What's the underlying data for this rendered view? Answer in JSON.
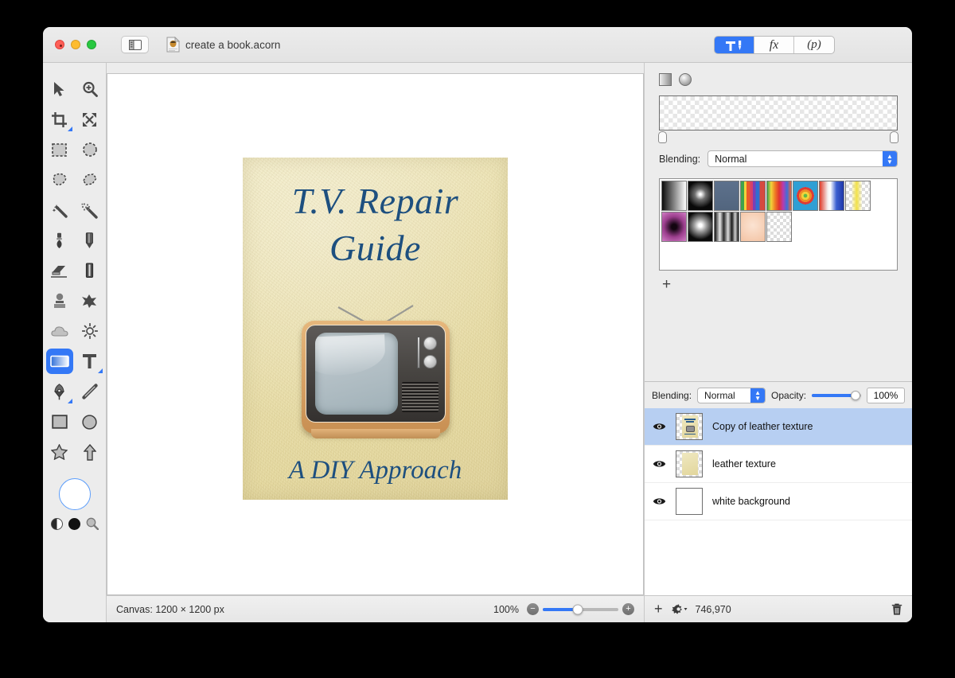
{
  "window": {
    "title": "create a book.acorn",
    "traffic_lights": [
      "close",
      "minimize",
      "zoom"
    ],
    "sidebar_toggle_icon": "sidebar-toggle-icon",
    "doc_icon": "acorn-document-icon"
  },
  "inspector_tabs": [
    {
      "id": "tools",
      "icon": "tools-hammer-icon",
      "label": "",
      "selected": true
    },
    {
      "id": "filters",
      "icon": "fx-icon",
      "label": "fx",
      "selected": false
    },
    {
      "id": "palettes",
      "icon": "palette-p-icon",
      "label": "(p)",
      "selected": false
    }
  ],
  "tools": {
    "items": [
      {
        "name": "move-tool",
        "icon": "arrow-cursor-icon",
        "selected": false
      },
      {
        "name": "zoom-tool",
        "icon": "magnifier-plus-icon",
        "selected": false
      },
      {
        "name": "crop-tool",
        "icon": "crop-icon",
        "selected": false,
        "has_options": true
      },
      {
        "name": "transform-tool",
        "icon": "move-arrows-icon",
        "selected": false
      },
      {
        "name": "rectangle-select-tool",
        "icon": "marquee-rect-icon",
        "selected": false
      },
      {
        "name": "ellipse-select-tool",
        "icon": "marquee-ellipse-icon",
        "selected": false
      },
      {
        "name": "lasso-tool",
        "icon": "lasso-icon",
        "selected": false
      },
      {
        "name": "polygon-lasso-tool",
        "icon": "polygon-lasso-icon",
        "selected": false
      },
      {
        "name": "magic-wand-tool",
        "icon": "magic-wand-icon",
        "selected": false
      },
      {
        "name": "instant-alpha-tool",
        "icon": "sparkle-wand-icon",
        "selected": false
      },
      {
        "name": "brush-tool",
        "icon": "paintbrush-icon",
        "selected": false
      },
      {
        "name": "pencil-tool",
        "icon": "pencil-icon",
        "selected": false
      },
      {
        "name": "eraser-tool",
        "icon": "eraser-icon",
        "selected": false
      },
      {
        "name": "paint-bucket-tool",
        "icon": "bucket-icon",
        "selected": false
      },
      {
        "name": "clone-stamp-tool",
        "icon": "clone-stamp-icon",
        "selected": false
      },
      {
        "name": "smudge-tool",
        "icon": "smudge-icon",
        "selected": false
      },
      {
        "name": "blur-tool",
        "icon": "cloud-blur-icon",
        "selected": false
      },
      {
        "name": "dodge-tool",
        "icon": "sun-dodge-icon",
        "selected": false
      },
      {
        "name": "gradient-tool",
        "icon": "gradient-icon",
        "selected": true
      },
      {
        "name": "text-tool",
        "icon": "text-t-icon",
        "selected": false,
        "has_options": true
      },
      {
        "name": "bezier-pen-tool",
        "icon": "pen-nib-icon",
        "selected": false,
        "has_options": true
      },
      {
        "name": "line-tool",
        "icon": "line-icon",
        "selected": false
      },
      {
        "name": "rectangle-shape-tool",
        "icon": "rectangle-icon",
        "selected": false
      },
      {
        "name": "ellipse-shape-tool",
        "icon": "ellipse-icon",
        "selected": false
      },
      {
        "name": "star-shape-tool",
        "icon": "star-icon",
        "selected": false
      },
      {
        "name": "arrow-shape-tool",
        "icon": "arrow-up-icon",
        "selected": false
      }
    ],
    "color_well": {
      "name": "foreground-color-well",
      "color": "#ffffff"
    },
    "color_controls": [
      {
        "name": "swap-colors-icon"
      },
      {
        "name": "default-colors-icon",
        "color": "#111111"
      },
      {
        "name": "color-picker-loupe-icon"
      }
    ]
  },
  "canvas": {
    "cover": {
      "title_line1": "T.V. Repair",
      "title_line2": "Guide",
      "subtitle": "A DIY Approach",
      "title_color": "#1d4f7f",
      "background_color": "#e9dfad",
      "artwork": "retro-television-illustration"
    }
  },
  "status_bar": {
    "canvas_label": "Canvas: 1200 × 1200 px",
    "zoom_label": "100%",
    "zoom_out_icon": "minus-circle-icon",
    "zoom_in_icon": "plus-circle-icon"
  },
  "gradient_panel": {
    "type_buttons": [
      {
        "name": "linear-gradient-button",
        "icon": "linear-gradient-icon"
      },
      {
        "name": "radial-gradient-button",
        "icon": "radial-gradient-icon"
      }
    ],
    "preview": "transparent-gradient-preview",
    "stops": [
      "left-stop-handle",
      "right-stop-handle"
    ],
    "blending_label": "Blending:",
    "blending_value": "Normal",
    "add_preset_icon": "plus-icon",
    "presets": [
      [
        {
          "name": "black-to-white",
          "css": "linear-gradient(90deg,#0b0b0b,#ffffff)"
        },
        {
          "name": "white-radial-on-black",
          "css": "radial-gradient(circle at 50% 45%, #ffffff 4%, #6f6f6f 28%, #090909 68%)"
        },
        {
          "name": "slate-blue",
          "css": "linear-gradient(180deg,#5d718c,#52657e)"
        },
        {
          "name": "rainbow-stripes-a",
          "css": "linear-gradient(90deg,#3fa34d 0 14%,#f0d23a 14% 24%,#ea5b2a 24% 38%,#d63f6a 38% 50%,#7b3fb5 50% 62%,#2f6fd0 62% 78%,#d64a3f 78% 100%)"
        },
        {
          "name": "rainbow-smooth",
          "css": "linear-gradient(90deg,#37a34a,#f2d33b,#ef7a24,#e1332f,#b83bb0,#3f6fd8,#e8623a)"
        },
        {
          "name": "bullseye",
          "css": "radial-gradient(circle at 50% 50%, #5fba46 0 10%, #f0d23a 10% 22%, #ef8b27 22% 34%, #e03a33 34% 46%, #2f9fd4 46% 100%)"
        },
        {
          "name": "red-white-blue",
          "css": "linear-gradient(90deg,#de3b2a,#f5f5f5 35%,#ffffff 45%,#3a5fd0 70%,#2037a8)"
        },
        {
          "name": "yellow-on-transparent",
          "css": "linear-gradient(90deg, rgba(255,255,255,0) 22%, #f2e24a 45%, rgba(255,255,255,0) 68%)"
        }
      ],
      [
        {
          "name": "magenta-radial",
          "css": "radial-gradient(circle at 50% 50%, #120510 0 14%, #9c3f8e 55%, #d27ec6 100%)"
        },
        {
          "name": "white-glow-radial",
          "css": "radial-gradient(circle at 50% 45%, #ffffff 8%, #9a9a9a 32%, #0a0a0a 72%)"
        },
        {
          "name": "metallic-stripes",
          "css": "linear-gradient(90deg,#111,#e8e8e8 22%,#2a2a2a 38%,#dcdcdc 56%,#1a1a1a 72%,#cfcfcf 86%,#141414)"
        },
        {
          "name": "peach",
          "css": "radial-gradient(circle at 50% 45%, #fbe3d2, #f3c3a3)"
        },
        {
          "name": "empty-transparent",
          "css": "transparent"
        }
      ]
    ]
  },
  "layers_panel": {
    "blending_label": "Blending:",
    "blending_value": "Normal",
    "opacity_label": "Opacity:",
    "opacity_value": "100%",
    "layers": [
      {
        "name": "Copy of leather texture",
        "visible": true,
        "selected": true,
        "thumb": "book-cover-thumb"
      },
      {
        "name": "leather texture",
        "visible": true,
        "selected": false,
        "thumb": "leather-thumb"
      },
      {
        "name": "white background",
        "visible": true,
        "selected": false,
        "thumb": "white-thumb"
      }
    ],
    "footer": {
      "add_icon": "plus-icon",
      "settings_icon": "gear-dropdown-icon",
      "memory_label": "746,970",
      "delete_icon": "trash-icon"
    }
  },
  "colors": {
    "accent": "#3478f6",
    "selection": "#b7cff2",
    "chrome": "#ececec"
  }
}
